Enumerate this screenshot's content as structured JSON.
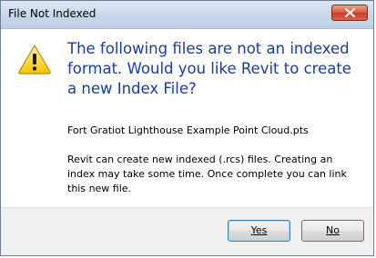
{
  "window": {
    "title": "File Not Indexed"
  },
  "dialog": {
    "main_instruction": "The following files are not an indexed format.  Would you like Revit to create a new Index File?",
    "file_name": "Fort Gratiot Lighthouse Example Point Cloud.pts",
    "description": "Revit can create new indexed (.rcs) files. Creating an index may take some time.  Once complete you can link this new file.",
    "icon": "warning-icon"
  },
  "buttons": {
    "yes_label": "Yes",
    "no_label": "No"
  },
  "colors": {
    "instruction_text": "#1c3d95",
    "close_button": "#c63a22",
    "footer_background": "#f0f0f0"
  }
}
